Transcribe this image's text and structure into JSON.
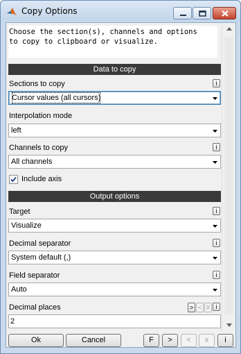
{
  "window": {
    "title": "Copy Options",
    "icon": "matlab-logo-icon"
  },
  "description": "Choose the section(s), channels and options\nto copy to clipboard or visualize.",
  "data_section": {
    "header": "Data to copy",
    "sections_label": "Sections to copy",
    "sections_value": "Cursor values (all cursors)",
    "interp_label": "Interpolation mode",
    "interp_value": "left",
    "channels_label": "Channels to copy",
    "channels_value": "All channels",
    "include_axis_label": "Include axis",
    "include_axis_checked": true
  },
  "output_section": {
    "header": "Output options",
    "target_label": "Target",
    "target_value": "Visualize",
    "decsep_label": "Decimal separator",
    "decsep_value": "System default (,)",
    "fieldsep_label": "Field separator",
    "fieldsep_value": "Auto",
    "decplaces_label": "Decimal places",
    "decplaces_value": "2"
  },
  "info_glyph": "i",
  "small_buttons": {
    "next": ">",
    "prev": "<",
    "clear": "X",
    "info": "i"
  },
  "buttons": {
    "ok": "Ok",
    "cancel": "Cancel",
    "f": "F",
    "next": ">",
    "prev": "<",
    "close": "x",
    "info": "i"
  },
  "colors": {
    "section_header_bg": "#3a3a3a",
    "window_frame": "#c9daec",
    "close_button": "#c4432c"
  }
}
